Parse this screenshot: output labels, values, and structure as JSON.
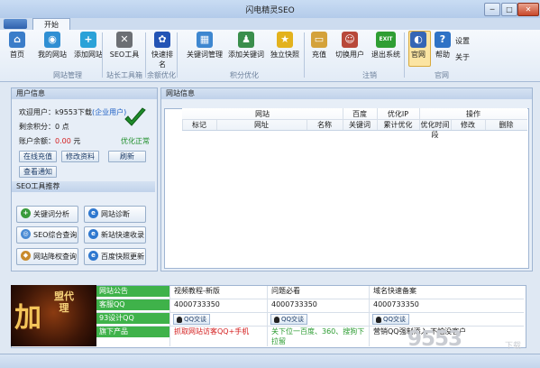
{
  "window": {
    "title": "闪电精灵SEO",
    "minimize": "─",
    "maximize": "□",
    "close": "✕"
  },
  "tabs": [
    {
      "label": "开始"
    }
  ],
  "ribbon": {
    "buttons": [
      {
        "label": "首页",
        "icon": "home-icon",
        "glyph": "⌂",
        "color": "#3b7dc9"
      },
      {
        "label": "我的网站",
        "icon": "globe-icon",
        "glyph": "◉",
        "color": "#2f8fd3"
      },
      {
        "label": "添加网站",
        "icon": "globe-add-icon",
        "glyph": "+",
        "color": "#2aa2d8"
      },
      {
        "label": "SEO工具",
        "icon": "tools-icon",
        "glyph": "✕",
        "color": "#6c6f74"
      },
      {
        "label": "快速排名",
        "icon": "paw-icon",
        "glyph": "✿",
        "color": "#2354b5"
      },
      {
        "label": "关键词管理",
        "icon": "network-icon",
        "glyph": "▦",
        "color": "#3e87d0"
      },
      {
        "label": "添加关键词",
        "icon": "user-add-icon",
        "glyph": "♟",
        "color": "#3a8e4c"
      },
      {
        "label": "独立快照",
        "icon": "star-icon",
        "glyph": "★",
        "color": "#e3b21d"
      },
      {
        "label": "充值",
        "icon": "card-icon",
        "glyph": "▭",
        "color": "#d4a23a"
      },
      {
        "label": "切换用户",
        "icon": "user-switch-icon",
        "glyph": "☺",
        "color": "#b8493a"
      },
      {
        "label": "退出系统",
        "icon": "exit-icon",
        "glyph": "EXIT",
        "color": "#2f9e33"
      },
      {
        "label": "官网",
        "icon": "official-site-icon",
        "glyph": "◐",
        "color": "#3566b5"
      },
      {
        "label": "帮助",
        "icon": "help-icon",
        "glyph": "?",
        "color": "#2f73c6"
      }
    ],
    "groups": [
      "网站管理",
      "站长工具箱",
      "余额优化",
      "积分优化",
      "注销",
      "官网"
    ],
    "settings_label": "设置",
    "about_label": "关于"
  },
  "user_panel": {
    "title": "用户信息",
    "welcome_prefix": "欢迎用户：",
    "username": "k9553下载",
    "user_type": "(企业用户)",
    "points_label": "剩余积分：",
    "points_value": "0 点",
    "balance_label": "账户余额：",
    "balance_value": "0.00",
    "balance_unit": "元",
    "status": "优化正常",
    "buttons": [
      "在线充值",
      "修改资料",
      "刷新",
      "查看通知"
    ]
  },
  "seo_tools": {
    "title": "SEO工具推荐",
    "items": [
      {
        "label": "关键词分析",
        "icon": "keyword-analysis-icon",
        "glyph": "+",
        "color": "#3a9b3c"
      },
      {
        "label": "网站诊断",
        "icon": "ie-icon",
        "glyph": "e",
        "color": "#2f78cf"
      },
      {
        "label": "SEO综合查询",
        "icon": "seo-query-icon",
        "glyph": "◎",
        "color": "#4a8bd4"
      },
      {
        "label": "新站快速收录",
        "icon": "ie-icon",
        "glyph": "e",
        "color": "#2f78cf"
      },
      {
        "label": "网站降权查询",
        "icon": "penalty-icon",
        "glyph": "◆",
        "color": "#c98b2c"
      },
      {
        "label": "百度快照更新",
        "icon": "ie-icon",
        "glyph": "e",
        "color": "#2f78cf"
      }
    ]
  },
  "site_info": {
    "title": "网站信息",
    "groups": [
      "网站",
      "百度",
      "优化IP",
      "操作"
    ],
    "columns": [
      "标记",
      "网址",
      "名称",
      "关键词",
      "累计优化",
      "优化时间段",
      "修改",
      "删除"
    ]
  },
  "bottom": {
    "ad_text": "加",
    "ad_text_side": "盟代理",
    "categories": [
      "网站公告",
      "客服QQ",
      "93设计QQ",
      "旗下产品"
    ],
    "col1": {
      "header": "视频教程-新版",
      "qq": "4000733350",
      "qq_btn": "QQ交谈",
      "product": "抓取网站访客QQ+手机"
    },
    "col2": {
      "header": "问题必看",
      "qq": "4000733350",
      "qq_btn": "QQ交谈",
      "product": "关下位一百度、360、搜狗下拉留"
    },
    "col3": {
      "header": "域名快速备案",
      "qq": "4000733350",
      "qq_btn": "QQ交谈",
      "product": "营销QQ强制添入 不怕没客户"
    }
  },
  "watermark": {
    "text": "9553",
    "sub": "下载"
  }
}
